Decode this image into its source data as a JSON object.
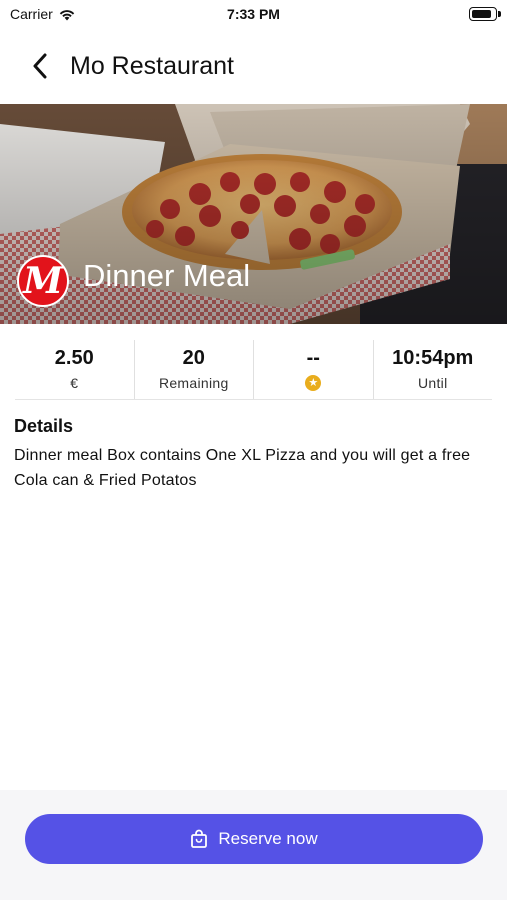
{
  "status_bar": {
    "carrier": "Carrier",
    "time": "7:33 PM",
    "battery_level": 0.9
  },
  "navbar": {
    "title": "Mo Restaurant",
    "back_icon": "chevron-left-icon"
  },
  "hero": {
    "meal_title": "Dinner Meal",
    "logo_letter": "M",
    "logo_color": "#e2131b"
  },
  "stats": [
    {
      "value": "2.50",
      "label": "€"
    },
    {
      "value": "20",
      "label": "Remaining"
    },
    {
      "value": "--",
      "label_icon": "star-icon"
    },
    {
      "value": "10:54pm",
      "label": "Until"
    }
  ],
  "details": {
    "title": "Details",
    "text": "Dinner meal Box contains One XL Pizza and you will get a free Cola can & Fried Potatos"
  },
  "footer": {
    "reserve_label": "Reserve now",
    "reserve_icon": "shopping-bag-icon",
    "accent_color": "#5552e6"
  }
}
